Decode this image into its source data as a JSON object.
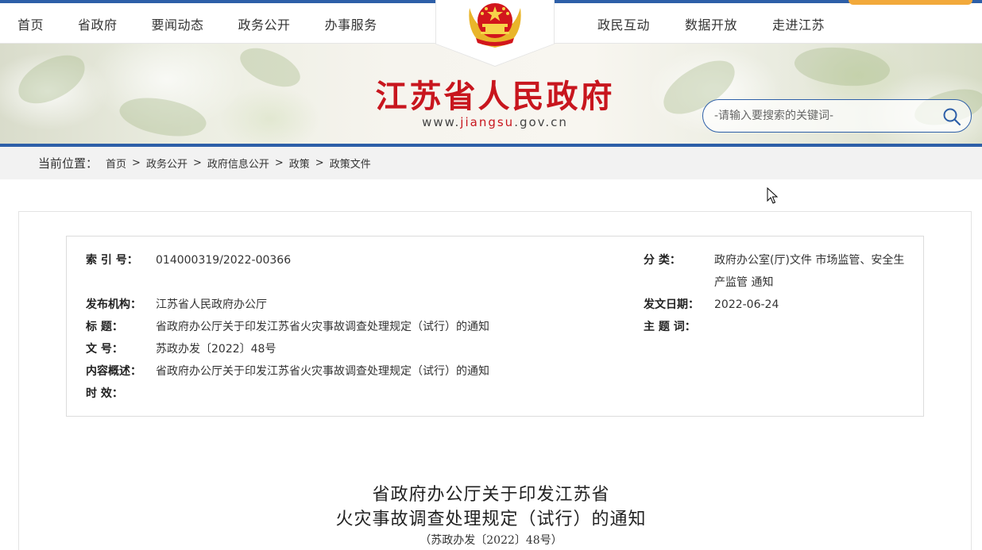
{
  "nav": {
    "left": [
      "首页",
      "省政府",
      "要闻动态",
      "政务公开",
      "办事服务"
    ],
    "right": [
      "政民互动",
      "数据开放",
      "走进江苏"
    ]
  },
  "header": {
    "title": "江苏省人民政府",
    "url_prefix": "www.",
    "url_domain": "jiangsu",
    "url_suffix": ".gov.cn",
    "emblem_icon": "national-emblem-icon"
  },
  "search": {
    "placeholder": "-请输入要搜索的关键词-",
    "icon": "search-icon"
  },
  "breadcrumb": {
    "label": "当前位置：",
    "items": [
      "首页",
      "政务公开",
      "政府信息公开",
      "政策",
      "政策文件"
    ],
    "separator": ">"
  },
  "meta": {
    "index_label": "索 引 号：",
    "index_value": "014000319/2022-00366",
    "category_label": "分 类：",
    "category_value": "政府办公室(厅)文件 市场监管、安全生产监管 通知",
    "publisher_label": "发布机构：",
    "publisher_value": "江苏省人民政府办公厅",
    "date_label": "发文日期：",
    "date_value": "2022-06-24",
    "title_label": "标 题：",
    "title_value": "省政府办公厅关于印发江苏省火灾事故调查处理规定（试行）的通知",
    "keywords_label": "主 题 词：",
    "keywords_value": "",
    "docno_label": "文 号：",
    "docno_value": "苏政办发〔2022〕48号",
    "summary_label": "内容概述：",
    "summary_value": "省政府办公厅关于印发江苏省火灾事故调查处理规定（试行）的通知",
    "validity_label": "时 效：",
    "validity_value": ""
  },
  "document": {
    "title_line1": "省政府办公厅关于印发江苏省",
    "title_line2": "火灾事故调查处理规定（试行）的通知",
    "number": "（苏政办发〔2022〕48号）"
  },
  "colors": {
    "brand_blue": "#2d5fa8",
    "title_red": "#c8161e",
    "accent_orange": "#f2a93b"
  }
}
